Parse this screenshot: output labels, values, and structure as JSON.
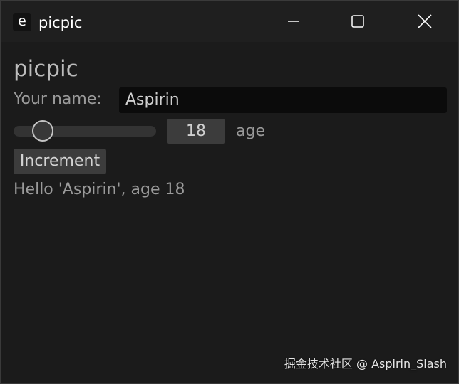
{
  "window": {
    "title": "picpic",
    "app_icon_glyph": "e",
    "icons": [
      "minimize-icon",
      "maximize-icon",
      "close-icon"
    ]
  },
  "content": {
    "heading": "picpic",
    "name_label": "Your name:",
    "name_value": "Aspirin",
    "age_slider": {
      "value": 18,
      "min": 0,
      "max": 120
    },
    "age_value": "18",
    "age_label": "age",
    "increment_label": "Increment",
    "greeting": "Hello 'Aspirin', age 18"
  },
  "watermark": "掘金技术社区 @ Aspirin_Slash",
  "colors": {
    "window_bg": "#1b1b1b",
    "titlebar_bg": "#1f1f1f",
    "input_bg": "#0b0b0b",
    "button_bg": "#3c3c3c",
    "text_dim": "#9a9a9a",
    "text_bright": "#ffffff"
  }
}
